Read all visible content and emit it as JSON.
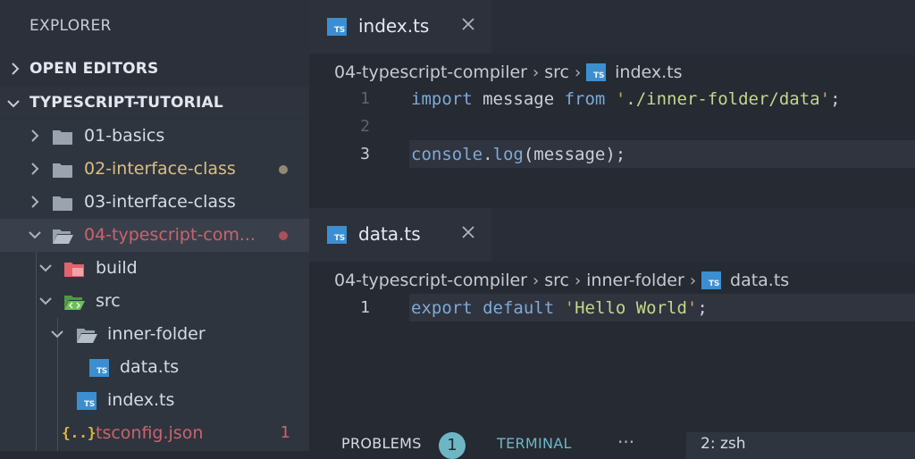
{
  "explorer": {
    "title": "EXPLORER",
    "open_editors": "OPEN EDITORS",
    "project": "TYPESCRIPT-TUTORIAL",
    "tree": [
      {
        "name": "01-basics",
        "color": "#d6dbe3"
      },
      {
        "name": "02-interface-class",
        "color": "#d9bf85",
        "status": "modified"
      },
      {
        "name": "03-interface-class",
        "color": "#d6dbe3"
      },
      {
        "name": "04-typescript-com...",
        "color": "#c9646c",
        "status": "error"
      },
      {
        "name": "build",
        "color": "#d6dbe3"
      },
      {
        "name": "src",
        "color": "#d6dbe3"
      },
      {
        "name": "inner-folder",
        "color": "#d6dbe3"
      },
      {
        "name": "data.ts",
        "color": "#d6dbe3"
      },
      {
        "name": "index.ts",
        "color": "#d6dbe3"
      },
      {
        "name": "tsconfig.json",
        "color": "#c9646c",
        "problems": "1"
      }
    ]
  },
  "editor1": {
    "tab": "index.ts",
    "crumbs": [
      "04-typescript-compiler",
      "src",
      "index.ts"
    ],
    "lines": [
      {
        "n": "1",
        "code": "import message from './inner-folder/data';"
      },
      {
        "n": "2",
        "code": ""
      },
      {
        "n": "3",
        "code": "console.log(message);"
      }
    ]
  },
  "editor2": {
    "tab": "data.ts",
    "crumbs": [
      "04-typescript-compiler",
      "src",
      "inner-folder",
      "data.ts"
    ],
    "lines": [
      {
        "n": "1",
        "code": "export default 'Hello World';"
      }
    ]
  },
  "panel": {
    "problems": "PROBLEMS",
    "problems_count": "1",
    "terminal": "TERMINAL",
    "more": "···",
    "terminal_select": "2: zsh"
  },
  "icons": {
    "ts_label": "TS",
    "json_label": "{..}"
  },
  "colors": {
    "accent_blue": "#3b8fd1",
    "folder_gray": "#9aa3ae",
    "build_red": "#e0646c",
    "src_green": "#6cbf5c",
    "modified_dot": "#8f8a74",
    "error_dot": "#a8525a",
    "terminal_tab": "#6fb6c4"
  }
}
